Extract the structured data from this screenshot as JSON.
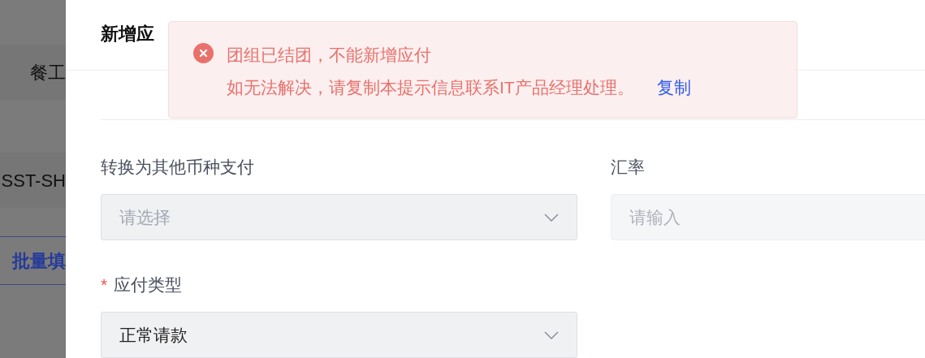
{
  "background_page": {
    "cells": [
      {
        "kind": "cell",
        "text": "餐工"
      },
      {
        "kind": "cell",
        "text": "SST-SH"
      },
      {
        "kind": "link",
        "text": "批量填"
      }
    ]
  },
  "dialog": {
    "title": "新增应",
    "fields": [
      {
        "kind": "select",
        "label": "转换为其他币种支付",
        "placeholder": "请选择"
      },
      {
        "kind": "input",
        "label": "汇率",
        "placeholder": "请输入"
      },
      {
        "kind": "select",
        "required_mark": "*",
        "label": "应付类型",
        "value": "正常请款"
      }
    ]
  },
  "toast": {
    "kind": "error",
    "title": "团组已结团，不能新增应付",
    "message": "如无法解决，请复制本提示信息联系IT产品经理处理。",
    "action": "复制"
  }
}
